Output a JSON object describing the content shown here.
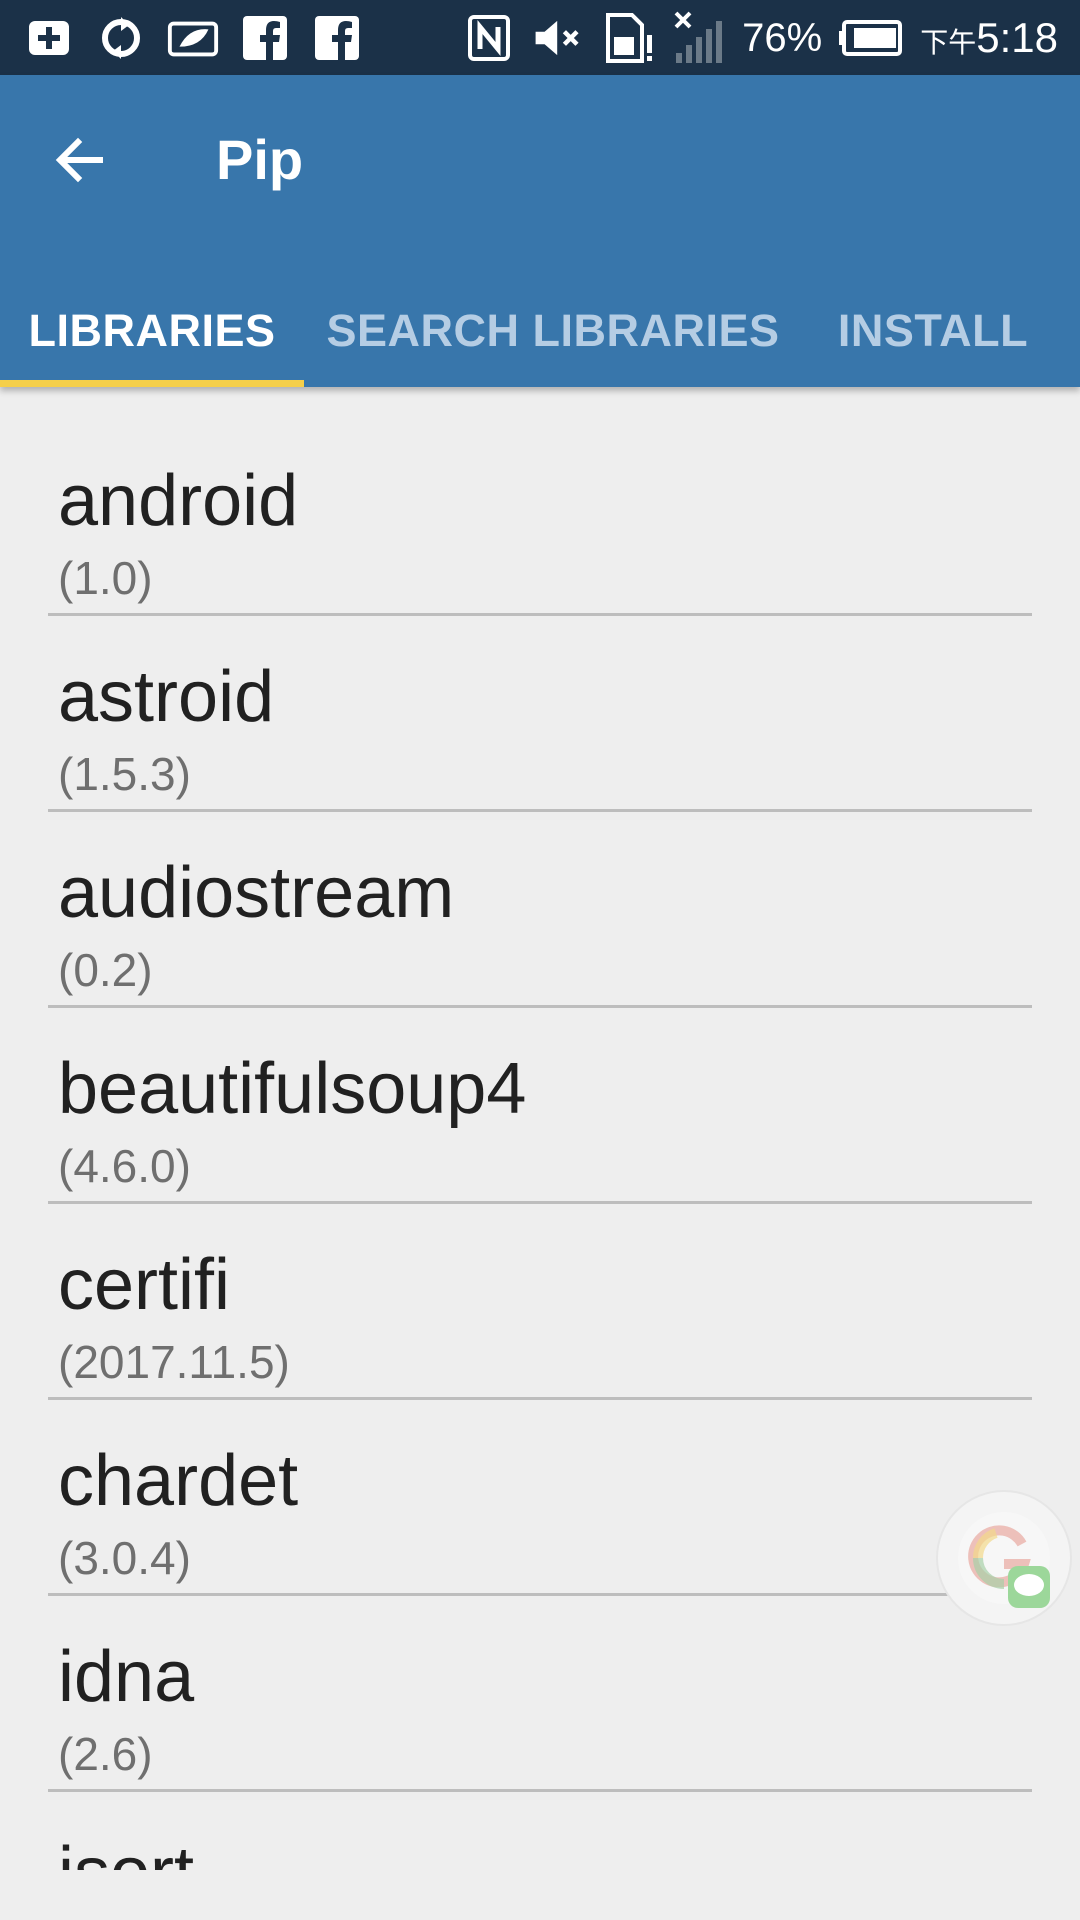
{
  "status_bar": {
    "left_icons": [
      "add-square-icon",
      "sync-icon",
      "leaf-icon",
      "facebook-icon",
      "facebook-icon"
    ],
    "right_icons": [
      "nfc-icon",
      "volume-mute-icon",
      "sim-alert-icon",
      "signal-off-icon",
      "battery-icon"
    ],
    "battery": "76%",
    "time_prefix": "下午",
    "time": "5:18"
  },
  "app_bar": {
    "title": "Pip",
    "back_icon": "arrow-back-icon"
  },
  "tabs": [
    {
      "label": "LIBRARIES",
      "active": true
    },
    {
      "label": "SEARCH LIBRARIES",
      "active": false
    },
    {
      "label": "INSTALL",
      "active": false
    }
  ],
  "libraries": [
    {
      "name": "android",
      "version": "(1.0)"
    },
    {
      "name": "astroid",
      "version": "(1.5.3)"
    },
    {
      "name": "audiostream",
      "version": "(0.2)"
    },
    {
      "name": "beautifulsoup4",
      "version": "(4.6.0)"
    },
    {
      "name": "certifi",
      "version": "(2017.11.5)"
    },
    {
      "name": "chardet",
      "version": "(3.0.4)"
    },
    {
      "name": "idna",
      "version": "(2.6)"
    },
    {
      "name": "isort",
      "version": ""
    }
  ],
  "floating_bubble": {
    "icon": "google-line-bubble-icon"
  },
  "colors": {
    "status_bar": "#1b3148",
    "app_bar": "#3876ab",
    "tab_indicator": "#f5cf4a",
    "background": "#eeeeee"
  }
}
